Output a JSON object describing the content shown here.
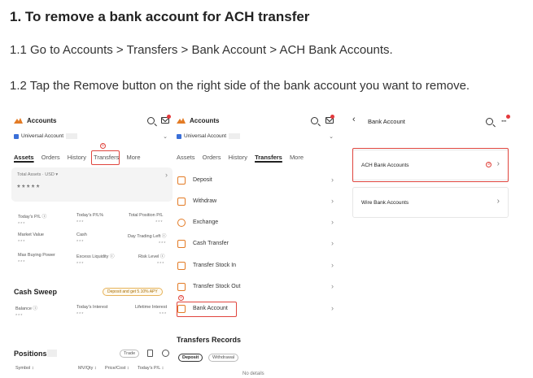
{
  "heading": "1. To remove a bank account for ACH transfer",
  "steps": [
    "1.1 Go to Accounts > Transfers > Bank Account > ACH Bank Accounts.",
    "1.2 Tap the Remove button on the right side of the bank account you want to remove."
  ],
  "colors": {
    "highlight": "#e0453e",
    "brand": "#e37b25",
    "notification": "#e4393c"
  },
  "screen1": {
    "title": "Accounts",
    "account_label": "Universal Account",
    "tabs": [
      "Assets",
      "Orders",
      "History",
      "Transfers",
      "More"
    ],
    "step_marker": "①",
    "total_assets_label": "Total Assets · USD ▾",
    "total_assets_value": "*****",
    "stats": [
      {
        "label": "Today's P/L ⓘ",
        "value": "***"
      },
      {
        "label": "Today's P/L%",
        "value": "***"
      },
      {
        "label": "Total Position P/L",
        "value": "***"
      },
      {
        "label": "Market Value",
        "value": "***"
      },
      {
        "label": "Cash",
        "value": "***"
      },
      {
        "label": "Day Trading Left ⓘ",
        "value": "***"
      },
      {
        "label": "Max Buying Power",
        "value": "***"
      },
      {
        "label": "Excess Liquidity ⓘ",
        "value": "***"
      },
      {
        "label": "Risk Level ⓘ",
        "value": "***"
      }
    ],
    "cash_sweep_title": "Cash Sweep",
    "cash_sweep_badge": "Deposit and get 5.10% APY",
    "cash_sweep_cols": [
      {
        "label": "Balance ⓘ",
        "value": "***"
      },
      {
        "label": "Today's Interest",
        "value": "***"
      },
      {
        "label": "Lifetime Interest",
        "value": "***"
      }
    ],
    "positions_title": "Positions",
    "positions_trade": "Trade",
    "positions_cols": [
      "Symbol ↕",
      "MV/Qty ↕",
      "Price/Cost ↕",
      "Today's P/L ↕"
    ]
  },
  "screen2": {
    "title": "Accounts",
    "account_label": "Universal Account",
    "tabs": [
      "Assets",
      "Orders",
      "History",
      "Transfers",
      "More"
    ],
    "menu": [
      "Deposit",
      "Withdraw",
      "Exchange",
      "Cash Transfer",
      "Transfer Stock In",
      "Transfer Stock Out",
      "Bank Account"
    ],
    "step_marker": "②",
    "records_title": "Transfers Records",
    "records_tabs": [
      "Deposit",
      "Withdrawal"
    ],
    "no_details": "No details"
  },
  "screen3": {
    "title": "Bank Account",
    "items": [
      "ACH Bank Accounts",
      "Wire Bank Accounts"
    ],
    "step_marker": "③"
  }
}
